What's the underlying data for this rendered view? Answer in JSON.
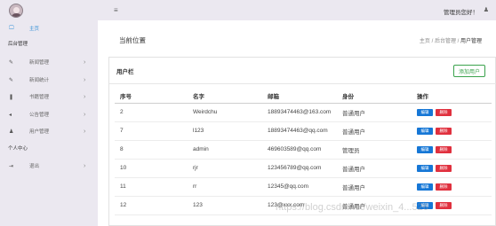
{
  "sidebar": {
    "items": [
      {
        "label": "主页",
        "icon": "monitor-icon",
        "glyph": "🖵",
        "active": true
      },
      {
        "label": "新闻管理",
        "icon": "edit-icon",
        "glyph": "✎"
      },
      {
        "label": "新闻统计",
        "icon": "edit-icon",
        "glyph": "✎"
      },
      {
        "label": "书籍管理",
        "icon": "book-icon",
        "glyph": "❚"
      },
      {
        "label": "公告管理",
        "icon": "megaphone-icon",
        "glyph": "◂"
      },
      {
        "label": "用户管理",
        "icon": "user-icon",
        "glyph": "♟"
      },
      {
        "label": "退出",
        "icon": "exit-icon",
        "glyph": "⇥"
      }
    ],
    "sections": {
      "admin": "后台管理",
      "personal": "个人中心"
    }
  },
  "topbar": {
    "menu_glyph": "≡",
    "greeting": "管理员您好！",
    "user_glyph": "♟"
  },
  "breadcrumb": {
    "title": "当前位置",
    "items": [
      "主页",
      "后台管理",
      "用户管理"
    ],
    "sep": " / "
  },
  "panel": {
    "title": "用户栏",
    "add_label": "添加用户"
  },
  "table": {
    "headers": [
      "序号",
      "名字",
      "邮箱",
      "身份",
      "操作"
    ],
    "rows": [
      {
        "id": "2",
        "name": "Weirdchu",
        "email": "18893474463@163.com",
        "role": "普通用户"
      },
      {
        "id": "7",
        "name": "l123",
        "email": "18893474463@qq.com",
        "role": "普通用户"
      },
      {
        "id": "8",
        "name": "admin",
        "email": "469603589@qq.com",
        "role": "管理员"
      },
      {
        "id": "10",
        "name": "rjr",
        "email": "123456789@qq.com",
        "role": "普通用户"
      },
      {
        "id": "11",
        "name": "rr",
        "email": "12345@qq.com",
        "role": "普通用户"
      },
      {
        "id": "12",
        "name": "123",
        "email": "123@xxx.com",
        "role": "普通用户"
      }
    ],
    "edit_label": "编辑",
    "delete_label": "删除"
  },
  "watermark": "https://blog.csdn.net/weixin_4...526",
  "colors": {
    "accent": "#2e8ed6",
    "edit": "#1677d6",
    "delete": "#e0303e",
    "add": "#3aa24c",
    "sidebar_bg": "#ebe8f0"
  }
}
